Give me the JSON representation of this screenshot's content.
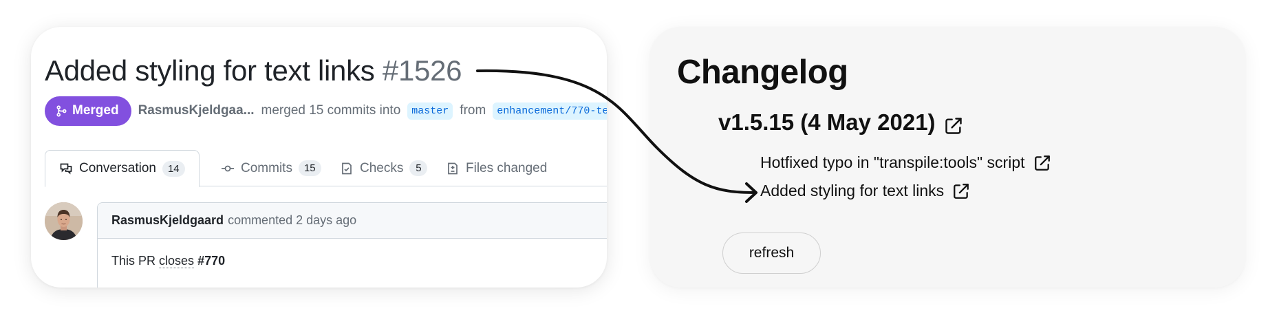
{
  "pr": {
    "title": "Added styling for text links",
    "number": "#1526",
    "status": "Merged",
    "author": "RasmusKjeldgaa...",
    "merge_text": "merged 15 commits into",
    "base_branch": "master",
    "from_text": "from",
    "head_branch": "enhancement/770-te",
    "tabs": [
      {
        "label": "Conversation",
        "count": "14",
        "icon": "comment-discussion-icon"
      },
      {
        "label": "Commits",
        "count": "15",
        "icon": "git-commit-icon"
      },
      {
        "label": "Checks",
        "count": "5",
        "icon": "checklist-icon"
      },
      {
        "label": "Files changed",
        "count": "",
        "icon": "file-diff-icon"
      }
    ],
    "comment": {
      "author": "RasmusKjeldgaard",
      "meta": "commented 2 days ago",
      "body_prefix": "This PR",
      "body_link": "closes",
      "body_issue": "#770"
    }
  },
  "changelog": {
    "title": "Changelog",
    "version": "v1.5.15 (4 May 2021)",
    "items": [
      {
        "text": "Hotfixed typo in \"transpile:tools\" script"
      },
      {
        "text": "Added styling for text links"
      }
    ],
    "refresh_label": "refresh"
  },
  "colors": {
    "merged": "#8250df",
    "link": "#0969da",
    "branch_bg": "#ddf4ff"
  }
}
